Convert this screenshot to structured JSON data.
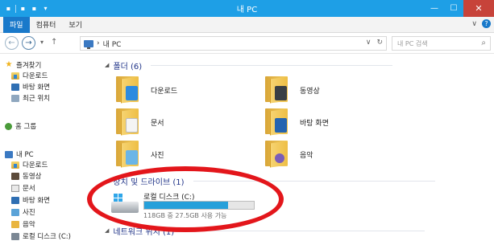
{
  "window": {
    "title": "내 PC",
    "minimize_glyph": "—",
    "maximize_glyph": "☐",
    "close_glyph": "✕"
  },
  "quick_access_toolbar": {
    "glyphs": [
      "▪",
      "▪",
      "▪",
      "▾"
    ]
  },
  "ribbon": {
    "tabs": [
      {
        "label": "파일"
      },
      {
        "label": "컴퓨터"
      },
      {
        "label": "보기"
      }
    ],
    "expand_glyph": "∨",
    "help_glyph": "?"
  },
  "address_bar": {
    "back_glyph": "←",
    "forward_glyph": "→",
    "recent_glyph": "▾",
    "up_glyph": "↑",
    "path_separator": "›",
    "path": "내 PC",
    "dropdown_glyph": "∨",
    "refresh_glyph": "↻"
  },
  "search": {
    "placeholder": "내 PC 검색",
    "icon": "search-icon",
    "glyph": "⌕"
  },
  "nav_pane": {
    "favorites": {
      "label": "즐겨찾기",
      "icon": "star-icon"
    },
    "favorite_items": [
      {
        "label": "다운로드",
        "icon": "downloads-icon"
      },
      {
        "label": "바탕 화면",
        "icon": "desktop-icon"
      },
      {
        "label": "최근 위치",
        "icon": "recent-places-icon"
      }
    ],
    "homegroup": {
      "label": "홈 그룹",
      "icon": "homegroup-icon"
    },
    "this_pc": {
      "label": "내 PC",
      "icon": "computer-icon"
    },
    "pc_items": [
      {
        "label": "다운로드",
        "icon": "downloads-icon"
      },
      {
        "label": "동영상",
        "icon": "videos-icon"
      },
      {
        "label": "문서",
        "icon": "documents-icon"
      },
      {
        "label": "바탕 화면",
        "icon": "desktop-icon"
      },
      {
        "label": "사진",
        "icon": "pictures-icon"
      },
      {
        "label": "음악",
        "icon": "music-icon"
      },
      {
        "label": "로컬 디스크 (C:)",
        "icon": "drive-icon"
      }
    ]
  },
  "content": {
    "folders_group": {
      "title": "폴더 (6)",
      "collapse_glyph": "◢"
    },
    "folders": [
      {
        "label": "다운로드",
        "icon": "downloads-folder-icon"
      },
      {
        "label": "동영상",
        "icon": "videos-folder-icon"
      },
      {
        "label": "문서",
        "icon": "documents-folder-icon"
      },
      {
        "label": "바탕 화면",
        "icon": "desktop-folder-icon"
      },
      {
        "label": "사진",
        "icon": "pictures-folder-icon"
      },
      {
        "label": "음악",
        "icon": "music-folder-icon"
      }
    ],
    "drives_group": {
      "title": "장치 및 드라이브 (1)",
      "collapse_glyph": "◢"
    },
    "drive": {
      "label": "로컬 디스크 (C:)",
      "free_text": "118GB 중 27.5GB 사용 가능",
      "used_fraction": 0.767,
      "bar_color": "#26a0da"
    },
    "network_group": {
      "title": "네트워크 위치 (1)",
      "collapse_glyph": "◢"
    }
  },
  "annotation": {
    "color": "#e3161b"
  }
}
